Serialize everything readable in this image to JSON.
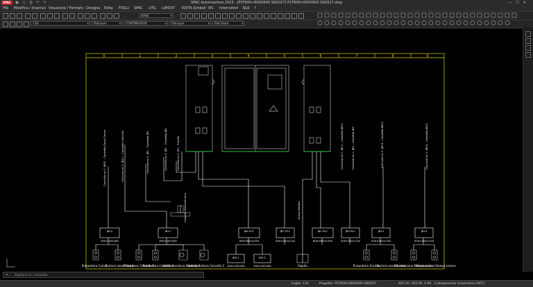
{
  "titlebar": {
    "logo": "SPAC",
    "title": "SPAC Automazione 2023 - [PCF600×600X600 SN2027]  PCF600×600X600 SN2027.dwg"
  },
  "menu": [
    "File",
    "Modifica / Inserisci",
    "Visualizza / Formato",
    "Disegna",
    "Edita",
    "FOGLI",
    "SPAC",
    "UTIL",
    "LAYOUT",
    "EDITA Simboli",
    "IEC",
    "Interruttori",
    "BLK",
    "?"
  ],
  "toolbar": {
    "sheet_number": "132",
    "style_select": "BASE",
    "layer1": "DaLayer",
    "linetype": "CONTINUOUS",
    "layer2": "DaLayer",
    "color": "DaColore"
  },
  "drawing": {
    "columns": [
      "0",
      "1",
      "2",
      "3",
      "4",
      "5",
      "6",
      "7",
      "8",
      "9"
    ],
    "vertical_labels": [
      "Conduttura C: JB3C - Cassetta Zona Carico",
      "Conduttura C: JB11 - Cassetta Cancello",
      "Conduttura C: JB1 - Cassetta JB1",
      "Conduttura C: JB1 - Cassetta JB2",
      "Conduttura C: JP1 - Pulpito",
      "Conduttura C: JB11 - Cassetta JB11",
      "Conduttura C: JB3 - Cassetta JB3",
      "Conduttura C: JB13 - Cassetta JB13",
      "Conduttura C: JB14 - Cassetta JB14",
      "Scava Metallo"
    ],
    "boxes": [
      {
        "id": "JB12",
        "size": "300×200×80"
      },
      {
        "id": "JB11",
        "size": "300×200×80"
      },
      {
        "id": "JB4 PLC",
        "size": "600×600×250"
      },
      {
        "id": "JB7 PLC",
        "size": "500×400×120"
      },
      {
        "id": "JB1 PLC",
        "size": "600×600×250"
      },
      {
        "id": "JB3 PLC",
        "size": "500×300×120"
      },
      {
        "id": "JB13",
        "size": "500×300×150"
      },
      {
        "id": "JB14",
        "size": "500×300×150"
      }
    ],
    "small_boxes": [
      {
        "id": "JB4.1",
        "size": "200×200×80"
      },
      {
        "id": "JB4.2",
        "size": "200×200×80"
      }
    ],
    "cassetta_label": "Cassetta Elettrotermica",
    "bottom_labels": [
      "Pulsantiera Carico",
      "Barriera zona Carico",
      "Pulsantiera Cancello 1",
      "Pulsantiera Cancello 2",
      "Elettroserratura Cancello 1",
      "Elettroserratura Cancello 2",
      "Pulpito",
      "Pulsantiera Scarico",
      "Barriera zona Scarico",
      "Barriera zona Rampa carico",
      "Barriera zona Rampa scarico"
    ]
  },
  "command": {
    "placeholder": "Digitare un comando"
  },
  "status": {
    "sheet": "Foglio: 132",
    "project": "Progetto: PCF600×600X600 SN2027",
    "coords": "492.50, 305.00, 0.00",
    "connection": "Collegamento Automatico [OFF]"
  },
  "colors": {
    "frame": "#d8d800",
    "lines": "#ffffff",
    "cabinet": "#a0a0a0",
    "green": "#2ecc40",
    "background": "#000000"
  }
}
